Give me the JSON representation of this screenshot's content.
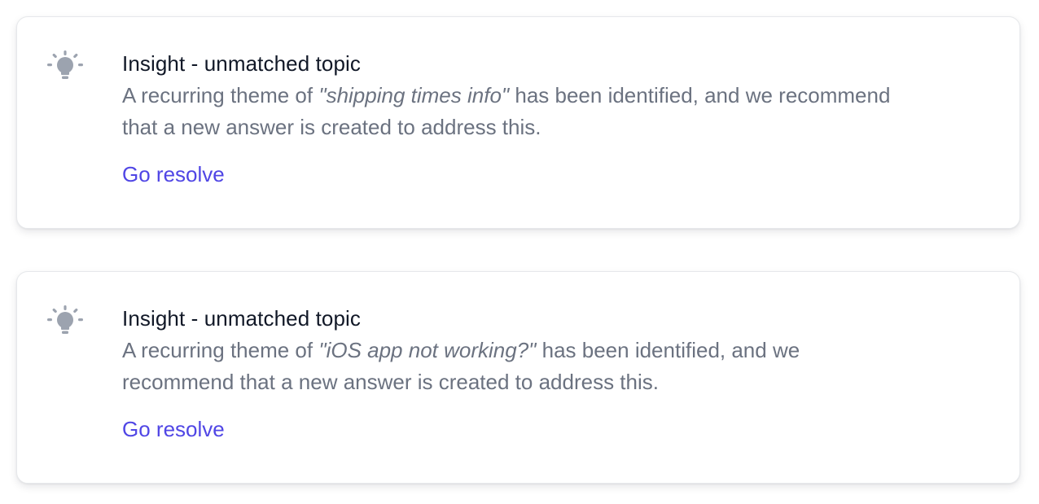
{
  "colors": {
    "title": "#111827",
    "body": "#6b7280",
    "link": "#5046e5",
    "icon": "#9ca3af",
    "card_border": "#e6e8eb"
  },
  "insights": [
    {
      "icon": "lightbulb-icon",
      "title": "Insight - unmatched topic",
      "description_prefix": "A recurring theme of ",
      "topic": "\"shipping times info\"",
      "description_suffix": " has been identified, and we recommend that a new answer is created to address this.",
      "action_label": "Go resolve"
    },
    {
      "icon": "lightbulb-icon",
      "title": "Insight - unmatched topic",
      "description_prefix": "A recurring theme of ",
      "topic": "\"iOS app not working?\"",
      "description_suffix": " has been identified, and we recommend that a new answer is created to address this.",
      "action_label": "Go resolve"
    }
  ]
}
